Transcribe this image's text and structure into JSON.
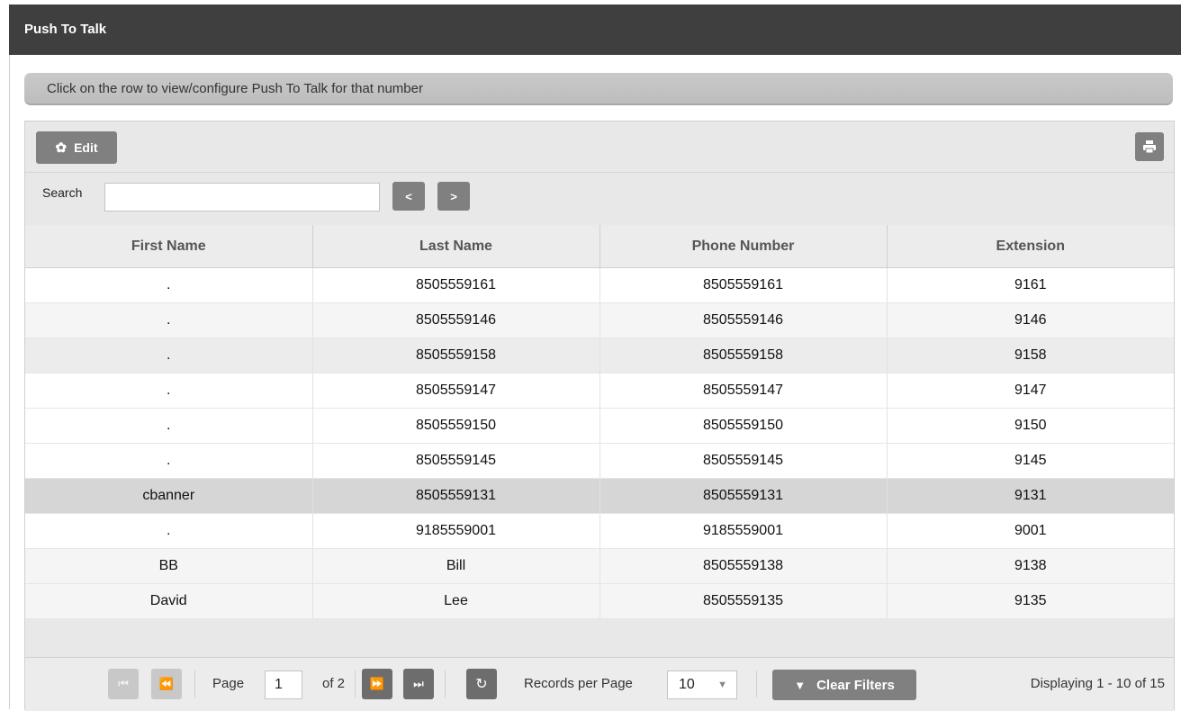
{
  "header": {
    "title": "Push To Talk"
  },
  "info": {
    "text": "Click on the row to view/configure Push To Talk for that number"
  },
  "toolbar": {
    "edit_label": "Edit",
    "edit_icon": "gear-icon",
    "print_icon": "printer-icon"
  },
  "search": {
    "label": "Search",
    "value": "",
    "prev_label": "<",
    "next_label": ">"
  },
  "table": {
    "columns": [
      "First Name",
      "Last Name",
      "Phone Number",
      "Extension"
    ],
    "rows": [
      [
        ".",
        "8505559161",
        "8505559161",
        "9161"
      ],
      [
        ".",
        "8505559146",
        "8505559146",
        "9146"
      ],
      [
        ".",
        "8505559158",
        "8505559158",
        "9158"
      ],
      [
        ".",
        "8505559147",
        "8505559147",
        "9147"
      ],
      [
        ".",
        "8505559150",
        "8505559150",
        "9150"
      ],
      [
        ".",
        "8505559145",
        "8505559145",
        "9145"
      ],
      [
        "cbanner",
        "8505559131",
        "8505559131",
        "9131"
      ],
      [
        ".",
        "9185559001",
        "9185559001",
        "9001"
      ],
      [
        "BB",
        "Bill",
        "8505559138",
        "9138"
      ],
      [
        "David",
        "Lee",
        "8505559135",
        "9135"
      ]
    ]
  },
  "pager": {
    "page_label": "Page",
    "page_value": "1",
    "of_label": "of 2",
    "records_label": "Records per Page",
    "records_value": "10",
    "clear_filters_label": "Clear Filters",
    "display_text": "Displaying 1 - 10 of 15"
  }
}
